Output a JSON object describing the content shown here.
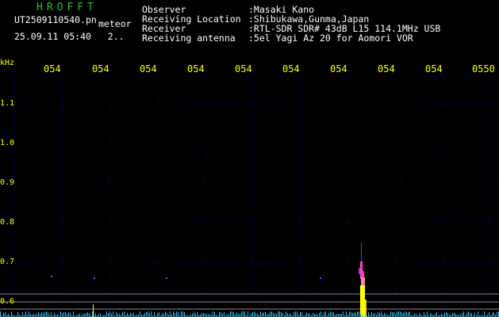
{
  "header": {
    "logo": "HROFFT",
    "filename": "UT2509110540.pn",
    "mode": "meteor",
    "datetime": "25.09.11 05:40",
    "extra": "2..",
    "info": [
      {
        "label": "Observer",
        "value": ":Masaki Kano"
      },
      {
        "label": "Receiving Location",
        "value": ":Shibukawa,Gunma,Japan"
      },
      {
        "label": "Receiver",
        "value": ":RTL-SDR SDR# 43dB L15 114.1MHz USB"
      },
      {
        "label": "Receiving antenna",
        "value": ":5el Yagi Az 20 for Aomori VOR"
      }
    ]
  },
  "axes": {
    "y_unit": "kHz",
    "x_ticks": [
      "054",
      "054",
      "054",
      "054",
      "054",
      "054",
      "054",
      "054",
      "054",
      "0550"
    ],
    "y_ticks": [
      "1.1",
      "1.0",
      "0.9",
      "0.8",
      "0.7",
      "0.6"
    ]
  },
  "colors": {
    "header_green": "#21c521",
    "tick_yellow": "#ffff00",
    "grid_blue": "#0a0a88",
    "signal_yellow": "#ffff00",
    "signal_magenta": "#ff40c0",
    "noise_cyan": "#30c0ff"
  }
}
